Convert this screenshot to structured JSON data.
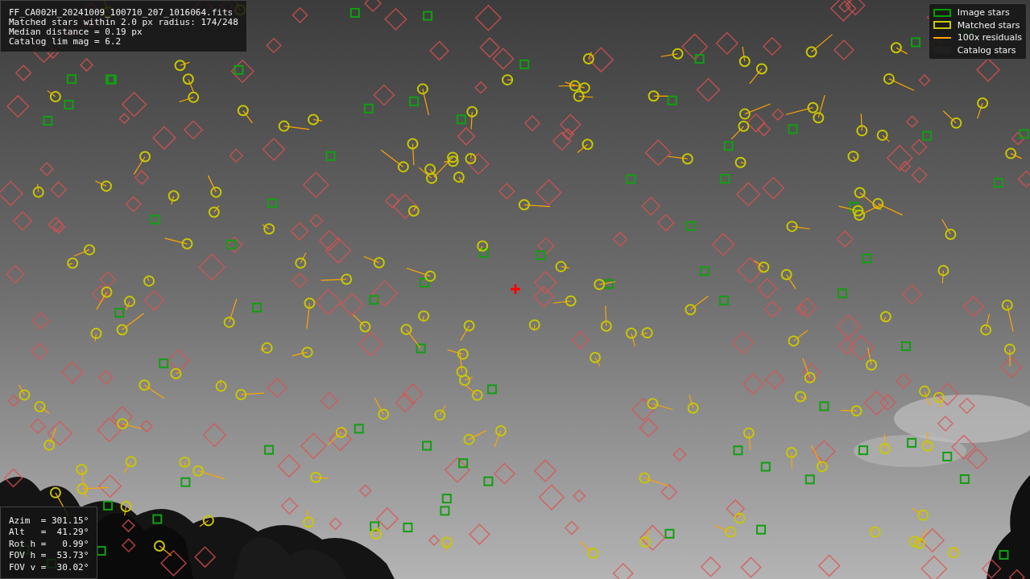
{
  "info_box": {
    "lines": [
      "FF_CA002H_20241009_100710_207_1016064.fits",
      "Matched stars within 2.0 px radius: 174/248",
      "Median distance = 0.19 px",
      "Catalog lim mag = 6.2"
    ]
  },
  "legend": [
    {
      "kind": "square",
      "color": "#00a000",
      "label": "Image stars"
    },
    {
      "kind": "square",
      "color": "#c8c800",
      "label": "Matched stars"
    },
    {
      "kind": "line",
      "color": "#ffa500",
      "label": "100x residuals"
    },
    {
      "kind": "none",
      "color": "#202020",
      "label": "Catalog stars"
    }
  ],
  "pointing_box": {
    "lines": [
      "Azim  = 301.15°",
      "Alt   =  41.29°",
      "Rot h =   0.99°",
      "FOV h =  53.73°",
      "FOV v =  30.02°"
    ]
  }
}
